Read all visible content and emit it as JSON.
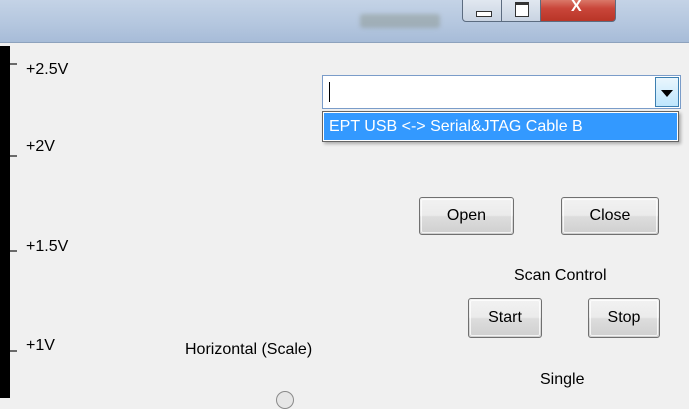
{
  "window": {
    "minimize_glyph": "—",
    "maximize_glyph": "□",
    "close_glyph": "X"
  },
  "scope": {
    "voltage_labels": [
      "+2.5V",
      "+2V",
      "+1.5V",
      "+1V"
    ]
  },
  "device_select": {
    "current_value": "",
    "options": [
      "EPT USB <-> Serial&JTAG Cable B"
    ],
    "highlighted_option": "EPT USB <-> Serial&JTAG Cable B"
  },
  "connection": {
    "open_label": "Open",
    "close_label": "Close"
  },
  "scan_control": {
    "title": "Scan Control",
    "start_label": "Start",
    "stop_label": "Stop"
  },
  "horizontal": {
    "label": "Horizontal  (Scale)"
  },
  "trigger": {
    "single_label": "Single"
  },
  "colors": {
    "selection": "#3399ff",
    "scope_background": "#000000",
    "window_face": "#f0f0f0",
    "close_button": "#c9463a"
  }
}
